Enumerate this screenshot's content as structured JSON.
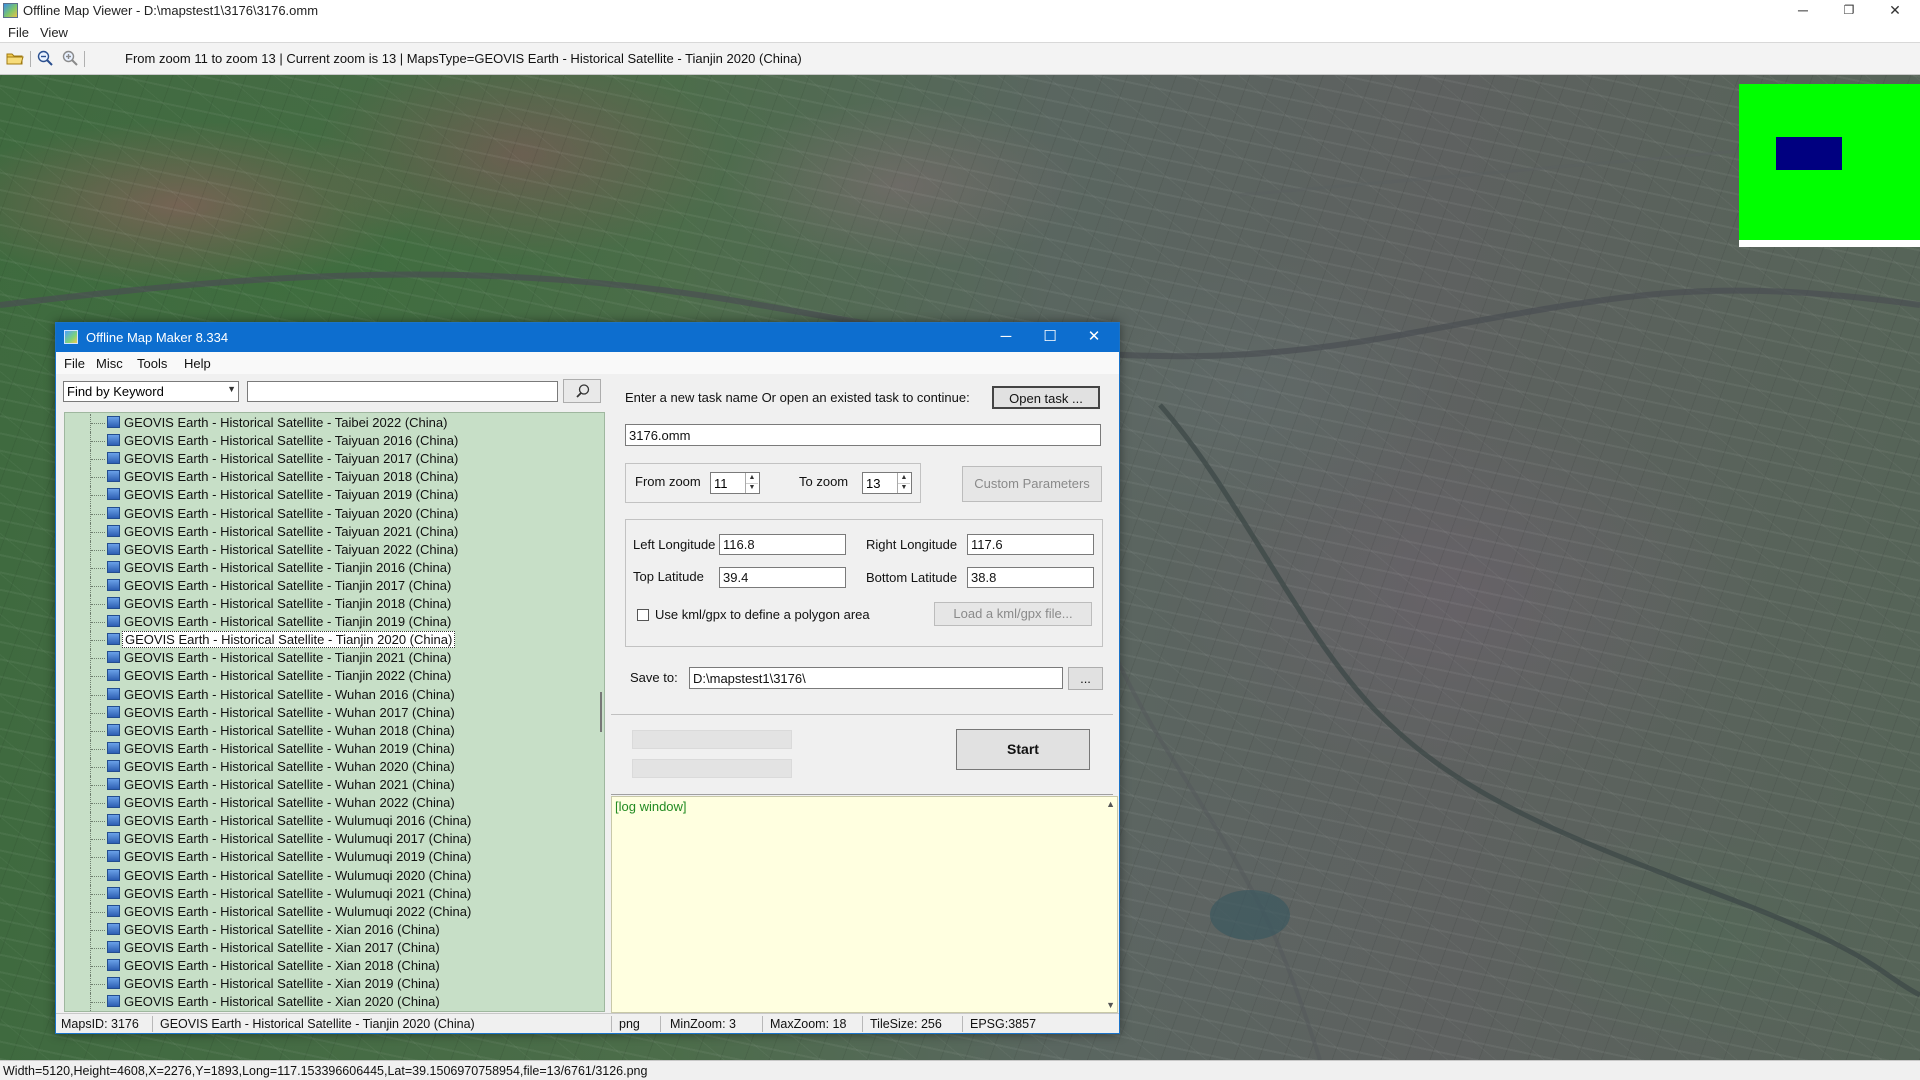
{
  "app": {
    "title": "Offline Map Viewer - D:\\mapstest1\\3176\\3176.omm",
    "menu": [
      "File",
      "View"
    ],
    "window_controls": {
      "minimize": "─",
      "maximize": "❐",
      "close": "✕"
    }
  },
  "toolbar": {
    "info": "From zoom 11 to zoom 13   |   Current zoom is 13  |   MapsType=GEOVIS Earth - Historical Satellite - Tianjin 2020 (China)",
    "icons": [
      "open-folder-icon",
      "zoom-out-icon",
      "zoom-in-icon"
    ]
  },
  "statusbar": {
    "text": "Width=5120,Height=4608,X=2276,Y=1893,Long=117.153396606445,Lat=39.1506970758954,file=13/6761/3126.png"
  },
  "dialog": {
    "title": "Offline Map Maker 8.334",
    "window_controls": {
      "minimize": "─",
      "maximize": "☐",
      "close": "✕"
    },
    "menu": [
      "File",
      "Misc",
      "Tools",
      "Help"
    ],
    "find": {
      "mode": "Find by Keyword",
      "keyword": ""
    },
    "tree_items": [
      "GEOVIS Earth - Historical Satellite - Taibei 2022 (China)",
      "GEOVIS Earth - Historical Satellite - Taiyuan 2016 (China)",
      "GEOVIS Earth - Historical Satellite - Taiyuan 2017 (China)",
      "GEOVIS Earth - Historical Satellite - Taiyuan 2018 (China)",
      "GEOVIS Earth - Historical Satellite - Taiyuan 2019 (China)",
      "GEOVIS Earth - Historical Satellite - Taiyuan 2020 (China)",
      "GEOVIS Earth - Historical Satellite - Taiyuan 2021 (China)",
      "GEOVIS Earth - Historical Satellite - Taiyuan 2022 (China)",
      "GEOVIS Earth - Historical Satellite - Tianjin 2016 (China)",
      "GEOVIS Earth - Historical Satellite - Tianjin 2017 (China)",
      "GEOVIS Earth - Historical Satellite - Tianjin 2018 (China)",
      "GEOVIS Earth - Historical Satellite - Tianjin 2019 (China)",
      "GEOVIS Earth - Historical Satellite - Tianjin 2020 (China)",
      "GEOVIS Earth - Historical Satellite - Tianjin 2021 (China)",
      "GEOVIS Earth - Historical Satellite - Tianjin 2022 (China)",
      "GEOVIS Earth - Historical Satellite - Wuhan 2016 (China)",
      "GEOVIS Earth - Historical Satellite - Wuhan 2017 (China)",
      "GEOVIS Earth - Historical Satellite - Wuhan 2018 (China)",
      "GEOVIS Earth - Historical Satellite - Wuhan 2019 (China)",
      "GEOVIS Earth - Historical Satellite - Wuhan 2020 (China)",
      "GEOVIS Earth - Historical Satellite - Wuhan 2021 (China)",
      "GEOVIS Earth - Historical Satellite - Wuhan 2022 (China)",
      "GEOVIS Earth - Historical Satellite - Wulumuqi 2016 (China)",
      "GEOVIS Earth - Historical Satellite - Wulumuqi 2017 (China)",
      "GEOVIS Earth - Historical Satellite - Wulumuqi 2019 (China)",
      "GEOVIS Earth - Historical Satellite - Wulumuqi 2020 (China)",
      "GEOVIS Earth - Historical Satellite - Wulumuqi 2021 (China)",
      "GEOVIS Earth - Historical Satellite - Wulumuqi 2022 (China)",
      "GEOVIS Earth - Historical Satellite - Xian 2016 (China)",
      "GEOVIS Earth - Historical Satellite - Xian 2017 (China)",
      "GEOVIS Earth - Historical Satellite - Xian 2018 (China)",
      "GEOVIS Earth - Historical Satellite - Xian 2019 (China)",
      "GEOVIS Earth - Historical Satellite - Xian 2020 (China)"
    ],
    "selected_item": "GEOVIS Earth - Historical Satellite - Tianjin 2020 (China)",
    "task": {
      "prompt": "Enter a new task name Or open an existed task to continue:",
      "open_button": "Open task ...",
      "name": "3176.omm"
    },
    "zoom": {
      "from_label": "From zoom",
      "from_value": "11",
      "to_label": "To zoom",
      "to_value": "13",
      "custom_button": "Custom Parameters"
    },
    "bounds": {
      "left_label": "Left Longitude",
      "left_value": "116.8",
      "right_label": "Right Longitude",
      "right_value": "117.6",
      "top_label": "Top Latitude",
      "top_value": "39.4",
      "bottom_label": "Bottom Latitude",
      "bottom_value": "38.8",
      "kml_label": "Use kml/gpx to define a polygon area",
      "kml_checked": false,
      "kml_button": "Load a kml/gpx file..."
    },
    "save": {
      "label": "Save to:",
      "path": "D:\\mapstest1\\3176\\",
      "browse": "..."
    },
    "start_button": "Start",
    "log": "[log window]",
    "status": {
      "maps_id": "MapsID: 3176",
      "maps_name": "GEOVIS Earth - Historical Satellite - Tianjin 2020 (China)",
      "format": "png",
      "min_zoom": "MinZoom: 3",
      "max_zoom": "MaxZoom: 18",
      "tile_size": "TileSize: 256",
      "epsg": "EPSG:3857"
    }
  },
  "colors": {
    "dialog_title_bg": "#0d6ecf",
    "tree_bg": "#c7dfc7",
    "log_bg": "#ffffe0",
    "log_text": "#228b22",
    "overview_bg": "#00ff00",
    "overview_viewport": "#000080"
  }
}
